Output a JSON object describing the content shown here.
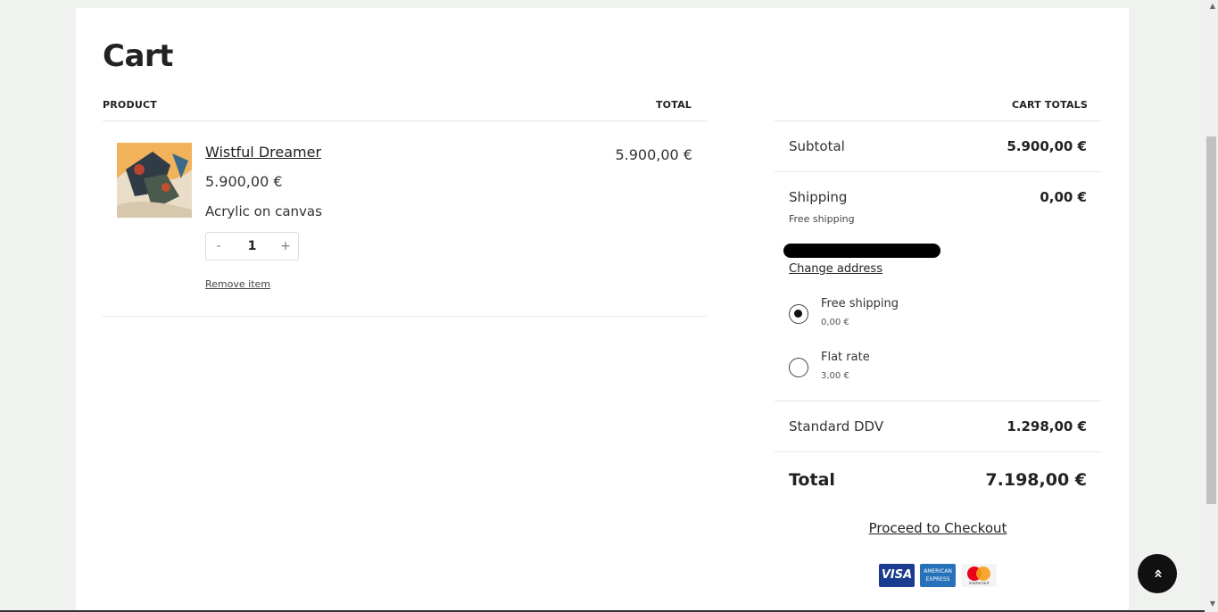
{
  "page": {
    "title": "Cart"
  },
  "table": {
    "product_header": "PRODUCT",
    "total_header": "TOTAL"
  },
  "item": {
    "name": "Wistful Dreamer",
    "price": "5.900,00 €",
    "description": "Acrylic on canvas",
    "quantity": "1",
    "minus": "-",
    "plus": "+",
    "remove_label": "Remove item",
    "line_total": "5.900,00 €"
  },
  "totals": {
    "header": "CART TOTALS",
    "subtotal_label": "Subtotal",
    "subtotal_value": "5.900,00 €",
    "shipping_label": "Shipping",
    "shipping_value": "0,00 €",
    "shipping_note": "Free shipping",
    "change_address": "Change address",
    "shipping_options": [
      {
        "name": "Free shipping",
        "price": "0,00 €",
        "selected": true
      },
      {
        "name": "Flat rate",
        "price": "3,00 €",
        "selected": false
      }
    ],
    "tax_label": "Standard DDV",
    "tax_value": "1.298,00 €",
    "total_label": "Total",
    "total_value": "7.198,00 €",
    "checkout_label": "Proceed to Checkout"
  },
  "payment": {
    "visa": "VISA",
    "amex_line1": "AMERICAN",
    "amex_line2": "EXPRESS",
    "mastercard": "mastercard"
  },
  "scroll_top_icon": "double-chevron-up-icon",
  "colors": {
    "background": "#f0f2ef",
    "panel": "#ffffff",
    "text": "#222222",
    "button": "#111111"
  }
}
